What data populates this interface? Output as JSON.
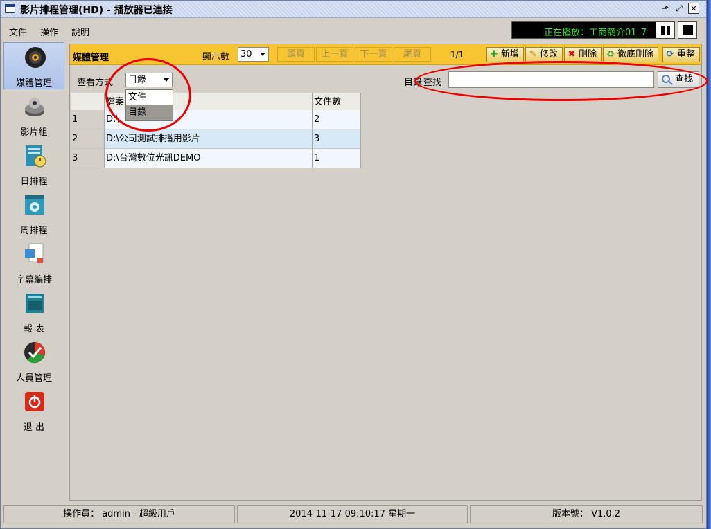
{
  "window": {
    "title": "影片排程管理(HD) - 播放器已連接",
    "controls": [
      "⬏",
      "⤢",
      "✕"
    ]
  },
  "menu": [
    "文件",
    "操作",
    "說明"
  ],
  "player": {
    "now_playing": "正在播放：工商簡介01_7"
  },
  "sidebar": {
    "items": [
      {
        "label": "媒體管理",
        "icon": "media-disc-icon",
        "active": true
      },
      {
        "label": "影片組",
        "icon": "film-group-icon"
      },
      {
        "label": "日排程",
        "icon": "daily-schedule-icon"
      },
      {
        "label": "周排程",
        "icon": "weekly-schedule-icon"
      },
      {
        "label": "字幕編排",
        "icon": "subtitle-icon"
      },
      {
        "label": "報 表",
        "icon": "report-icon"
      },
      {
        "label": "人員管理",
        "icon": "user-management-icon"
      },
      {
        "label": "退 出",
        "icon": "exit-icon"
      }
    ]
  },
  "panel": {
    "title": "媒體管理",
    "show_count_label": "顯示數",
    "show_count": "30",
    "pager": [
      "頭頁",
      "上一頁",
      "下一頁",
      "尾頁"
    ],
    "page_info": "1/1",
    "actions": [
      {
        "label": "新增",
        "icon": "plus-icon"
      },
      {
        "label": "修改",
        "icon": "pencil-icon"
      },
      {
        "label": "刪除",
        "icon": "delete-x-icon"
      },
      {
        "label": "徹底刪除",
        "icon": "recycle-icon"
      },
      {
        "label": "重整",
        "icon": "refresh-icon"
      }
    ]
  },
  "filter": {
    "view_label": "查看方式",
    "view_value": "目錄",
    "options": [
      "文件",
      "目錄"
    ],
    "selected_option": "目錄",
    "dir_label": "目錄",
    "search_overlay": "查找",
    "search_value": "",
    "search_button": "查找"
  },
  "table": {
    "columns": [
      "",
      "檔案",
      "文件數"
    ],
    "rows": [
      {
        "index": "1",
        "path": "D:\\",
        "count": "2"
      },
      {
        "index": "2",
        "path": "D:\\公司測試排播用影片",
        "count": "3"
      },
      {
        "index": "3",
        "path": "D:\\台灣數位光訊DEMO",
        "count": "1"
      }
    ]
  },
  "status": {
    "operator": "操作員： admin - 超級用戶",
    "datetime": "2014-11-17 09:10:17 星期一",
    "version": "版本號： V1.0.2"
  },
  "colors": {
    "header_yellow": "#f7c531",
    "annotation_red": "#e00000",
    "now_playing_green": "#30e030"
  }
}
